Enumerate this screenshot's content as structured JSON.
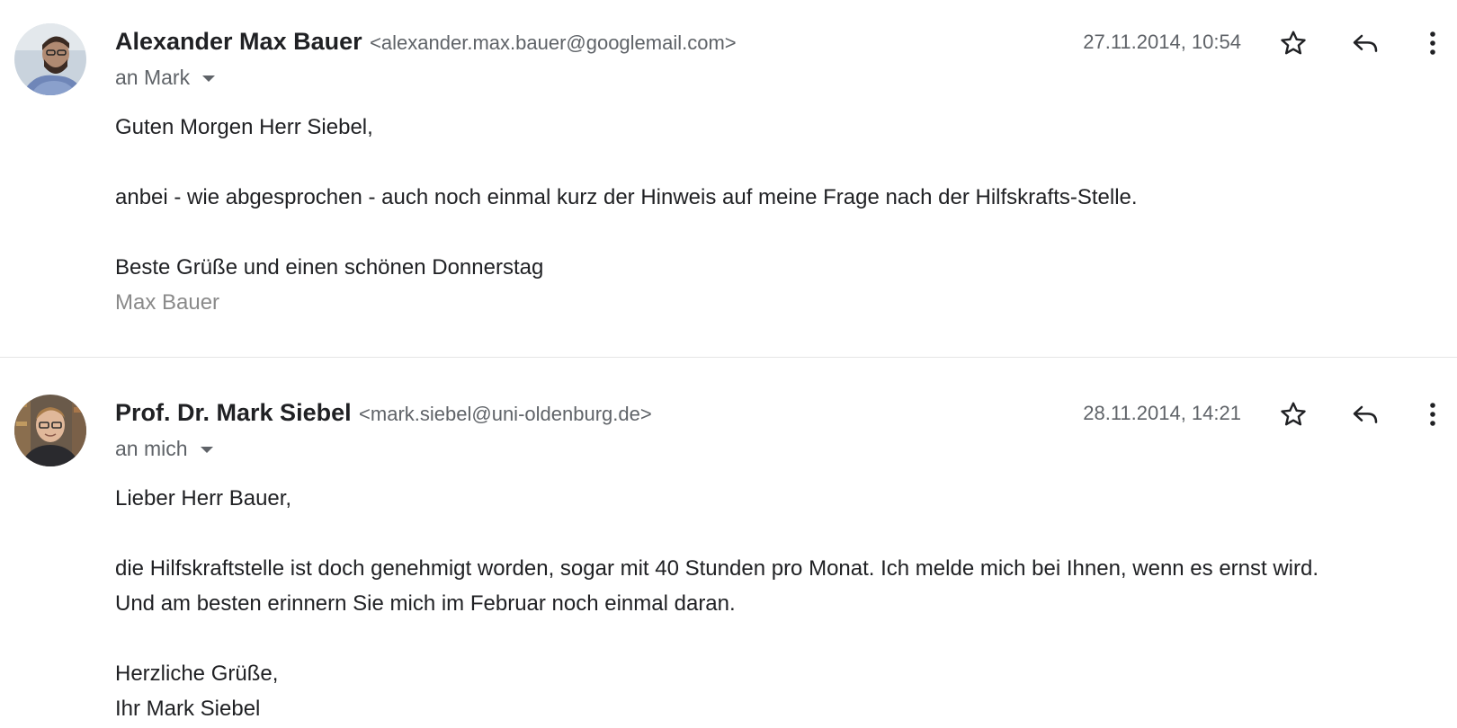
{
  "messages": [
    {
      "sender_name": "Alexander Max Bauer",
      "sender_email": "<alexander.max.bauer@googlemail.com>",
      "recipient": "an Mark",
      "date": "27.11.2014, 10:54",
      "body": {
        "greeting": "Guten Morgen Herr Siebel,",
        "paragraph1": "anbei - wie abgesprochen - auch noch einmal kurz der Hinweis auf meine Frage nach der Hilfskrafts-Stelle.",
        "closing": "Beste Grüße und einen schönen Donnerstag",
        "signature": "Max Bauer"
      }
    },
    {
      "sender_name": "Prof. Dr. Mark Siebel",
      "sender_email": "<mark.siebel@uni-oldenburg.de>",
      "recipient": "an mich",
      "date": "28.11.2014, 14:21",
      "body": {
        "greeting": "Lieber Herr Bauer,",
        "paragraph1_line1": "die Hilfskraftstelle ist doch genehmigt worden, sogar mit 40 Stunden pro Monat. Ich melde mich bei Ihnen, wenn es ernst wird.",
        "paragraph1_line2": "Und am besten erinnern Sie mich im Februar noch einmal daran.",
        "closing": "Herzliche Grüße,",
        "signature": "Ihr Mark Siebel"
      }
    }
  ],
  "icons": {
    "star": "star-icon",
    "reply": "reply-icon",
    "more": "more-vert-icon",
    "dropdown": "chevron-down-icon"
  },
  "colors": {
    "text": "#202124",
    "muted": "#5f6368",
    "signature_muted": "#8a8a8a",
    "divider": "#e5e5e5"
  }
}
